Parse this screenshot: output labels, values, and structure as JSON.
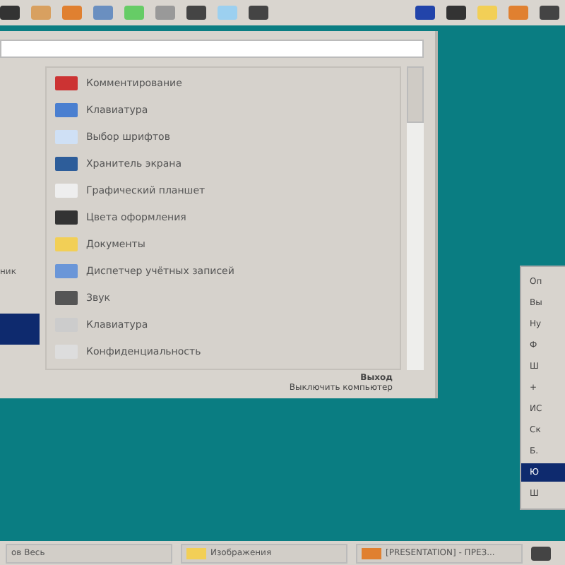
{
  "window": {
    "left_pane": {
      "items": [
        {
          "label": "ник",
          "selected": false
        },
        {
          "selected": true
        }
      ]
    },
    "items": [
      {
        "label": "Комментирование"
      },
      {
        "label": "Клавиатура"
      },
      {
        "label": "Выбор шрифтов"
      },
      {
        "label": "Хранитель экрана"
      },
      {
        "label": "Графический планшет"
      },
      {
        "label": "Цвета оформления"
      },
      {
        "label": "Документы"
      },
      {
        "label": "Диспетчер учётных записей"
      },
      {
        "label": "Звук"
      },
      {
        "label": "Клавиатура"
      },
      {
        "label": "Конфиденциальность"
      }
    ],
    "logout": "Выход",
    "shutdown": "Выключить компьютер"
  },
  "context_menu": {
    "items": [
      {
        "label": "Оп",
        "selected": false
      },
      {
        "label": "Вы",
        "selected": false
      },
      {
        "label": "Ну",
        "selected": false
      },
      {
        "label": "Ф",
        "selected": false
      },
      {
        "label": "Ш",
        "selected": false
      },
      {
        "label": "+",
        "selected": false
      },
      {
        "label": "ИС",
        "selected": false
      },
      {
        "label": "Ск",
        "selected": false
      },
      {
        "label": "Б.",
        "selected": false
      },
      {
        "label": "Ю",
        "selected": true
      },
      {
        "label": "Ш",
        "selected": false
      }
    ]
  },
  "taskbar": {
    "tasks": [
      {
        "label": "ов Весь"
      },
      {
        "label": "Изображения"
      },
      {
        "label": "[PRESENTATION] - ПРЕЗ..."
      }
    ]
  }
}
